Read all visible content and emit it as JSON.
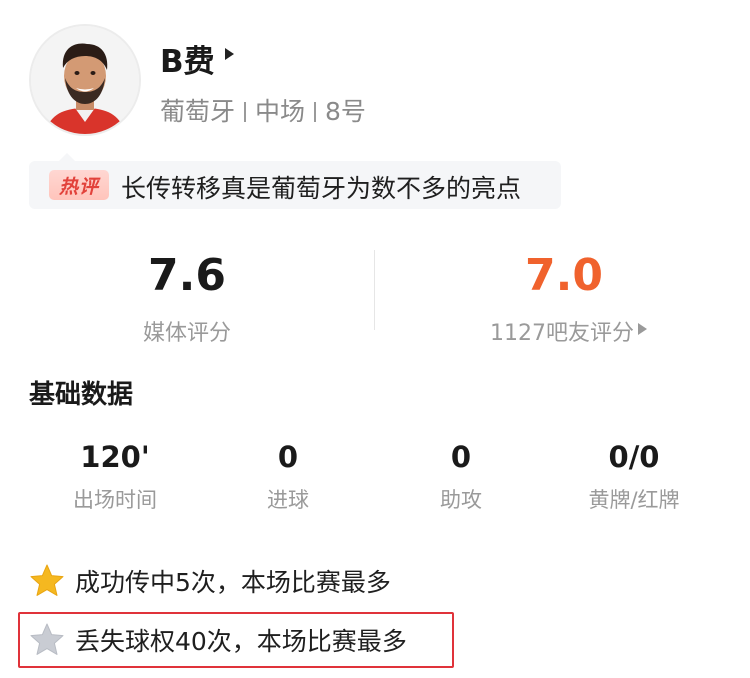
{
  "player": {
    "name": "B费",
    "country": "葡萄牙",
    "position": "中场",
    "number": "8号"
  },
  "hot_comment": {
    "badge": "热评",
    "text": "长传转移真是葡萄牙为数不多的亮点"
  },
  "ratings": {
    "media": {
      "value": "7.6",
      "label": "媒体评分"
    },
    "fans": {
      "value": "7.0",
      "label": "1127吧友评分"
    }
  },
  "basic_stats": {
    "title": "基础数据",
    "items": [
      {
        "value": "120'",
        "label": "出场时间"
      },
      {
        "value": "0",
        "label": "进球"
      },
      {
        "value": "0",
        "label": "助攻"
      },
      {
        "value": "0/0",
        "label": "黄牌/红牌"
      }
    ]
  },
  "highlights": [
    {
      "text": "成功传中5次，本场比赛最多",
      "icon": "gold-star-icon",
      "color": "#f5b820"
    },
    {
      "text": "丢失球权40次，本场比赛最多",
      "icon": "grey-star-icon",
      "color": "#c9ccd3"
    }
  ],
  "colors": {
    "fan_rating": "#f0622d",
    "hot_badge": "#e2423b",
    "highlight_border": "#e0333a"
  }
}
